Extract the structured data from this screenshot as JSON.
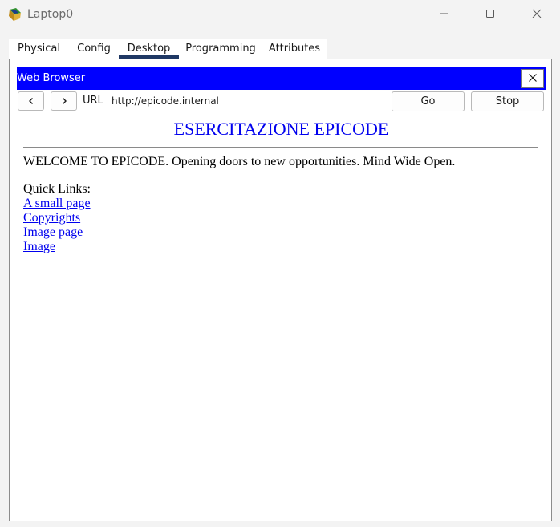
{
  "window": {
    "title": "Laptop0",
    "icon": "laptop-app-icon",
    "controls": [
      "minimize-icon",
      "maximize-icon",
      "close-icon"
    ]
  },
  "tabs": [
    {
      "label": "Physical"
    },
    {
      "label": "Config"
    },
    {
      "label": "Desktop",
      "active": true
    },
    {
      "label": "Programming"
    },
    {
      "label": "Attributes"
    }
  ],
  "browser": {
    "title": "Web Browser",
    "url_label": "URL",
    "url": "http://epicode.internal",
    "go_label": "Go",
    "stop_label": "Stop",
    "header_color": "#0000ff",
    "back_icon": "chevron-left-icon",
    "forward_icon": "chevron-right-icon"
  },
  "page": {
    "heading": "ESERCITAZIONE EPICODE",
    "welcome": "WELCOME TO EPICODE. Opening doors to new opportunities. Mind Wide Open.",
    "quick_links_label": "Quick Links:",
    "links": [
      {
        "label": "A small page"
      },
      {
        "label": "Copyrights"
      },
      {
        "label": "Image page"
      },
      {
        "label": "Image"
      }
    ],
    "link_color": "#0000ee"
  }
}
